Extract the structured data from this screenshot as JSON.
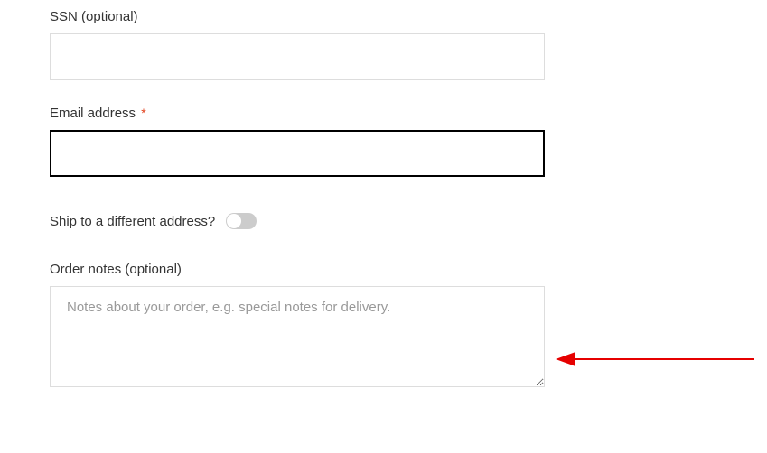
{
  "fields": {
    "ssn": {
      "label": "SSN (optional)",
      "value": ""
    },
    "email": {
      "label": "Email address",
      "required_mark": "*",
      "value": ""
    },
    "ship_different": {
      "label": "Ship to a different address?",
      "value": false
    },
    "order_notes": {
      "label": "Order notes (optional)",
      "placeholder": "Notes about your order, e.g. special notes for delivery.",
      "value": ""
    }
  }
}
